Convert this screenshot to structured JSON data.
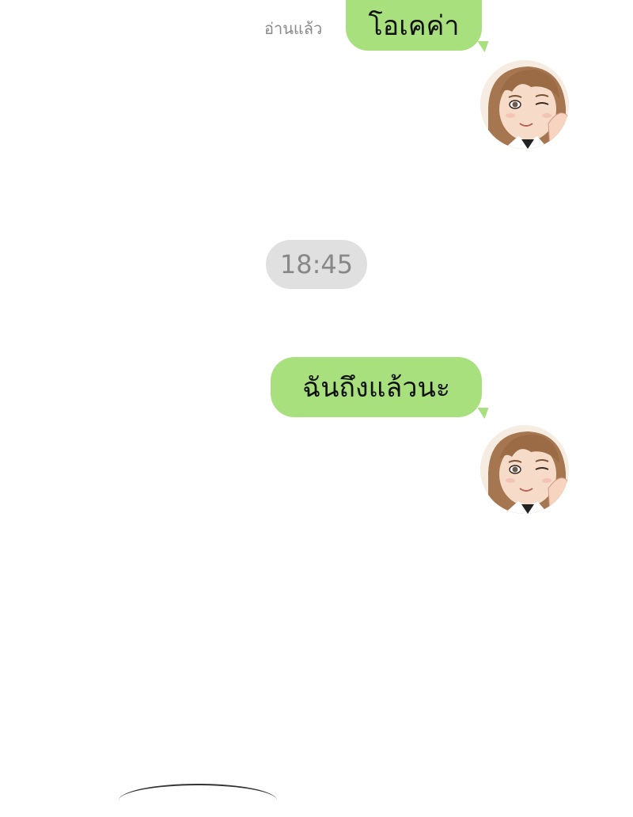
{
  "chat": {
    "messages": [
      {
        "text": "โอเคค่า",
        "read_label": "อ่านแล้ว"
      },
      {
        "text": "ฉันถึงแล้วนะ"
      }
    ],
    "timestamp": "18:45"
  },
  "colors": {
    "bubble_green": "#a7e07c",
    "time_pill_bg": "#e0e0e0",
    "time_text": "#888888",
    "read_label": "#8a8a8a"
  },
  "icons": {
    "avatar": "girl-winking-avatar-icon"
  }
}
